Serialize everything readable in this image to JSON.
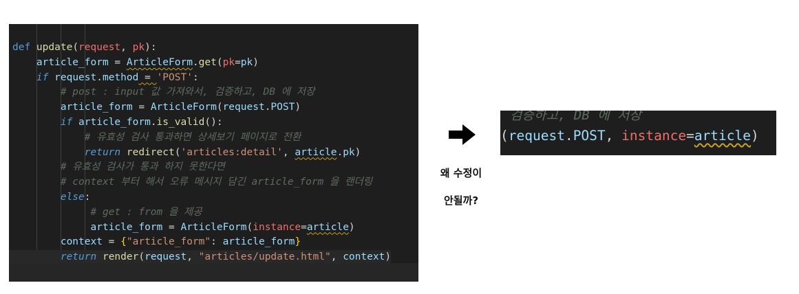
{
  "editor": {
    "language": "python",
    "lines": [
      [
        {
          "t": "def ",
          "c": "kw"
        },
        {
          "t": "update",
          "c": "fn"
        },
        {
          "t": "(",
          "c": "plain"
        },
        {
          "t": "request",
          "c": "par"
        },
        {
          "t": ", ",
          "c": "plain"
        },
        {
          "t": "pk",
          "c": "par"
        },
        {
          "t": "):",
          "c": "plain"
        }
      ],
      [
        {
          "t": "    ",
          "c": "plain"
        },
        {
          "t": "article_form",
          "c": "var"
        },
        {
          "t": " = ",
          "c": "plain"
        },
        {
          "t": "ArticleForm",
          "c": "var",
          "squig": true
        },
        {
          "t": ".",
          "c": "plain"
        },
        {
          "t": "get",
          "c": "fn"
        },
        {
          "t": "(",
          "c": "plain"
        },
        {
          "t": "pk",
          "c": "par"
        },
        {
          "t": "=",
          "c": "plain"
        },
        {
          "t": "pk",
          "c": "var"
        },
        {
          "t": ")",
          "c": "plain"
        }
      ],
      [
        {
          "t": "    ",
          "c": "plain"
        },
        {
          "t": "if",
          "c": "kwi"
        },
        {
          "t": " ",
          "c": "plain"
        },
        {
          "t": "request",
          "c": "var"
        },
        {
          "t": ".",
          "c": "plain"
        },
        {
          "t": "method",
          "c": "var"
        },
        {
          "t": " = ",
          "c": "plain",
          "squig": true
        },
        {
          "t": "'POST'",
          "c": "str"
        },
        {
          "t": ":",
          "c": "plain"
        }
      ],
      [
        {
          "t": "        ",
          "c": "plain"
        },
        {
          "t": "# post : input 값 가져와서, 검증하고, DB 에 저장",
          "c": "cm"
        }
      ],
      [
        {
          "t": "        ",
          "c": "plain"
        },
        {
          "t": "article_form",
          "c": "var"
        },
        {
          "t": " = ",
          "c": "plain"
        },
        {
          "t": "ArticleForm",
          "c": "var"
        },
        {
          "t": "(",
          "c": "plain"
        },
        {
          "t": "request",
          "c": "var"
        },
        {
          "t": ".",
          "c": "plain"
        },
        {
          "t": "POST",
          "c": "var"
        },
        {
          "t": ")",
          "c": "plain"
        }
      ],
      [
        {
          "t": "        ",
          "c": "plain"
        },
        {
          "t": "if",
          "c": "kwi"
        },
        {
          "t": " ",
          "c": "plain"
        },
        {
          "t": "article_form",
          "c": "var"
        },
        {
          "t": ".",
          "c": "plain"
        },
        {
          "t": "is_valid",
          "c": "fn"
        },
        {
          "t": "():",
          "c": "plain"
        }
      ],
      [
        {
          "t": "            ",
          "c": "plain"
        },
        {
          "t": "# 유효성 검사 통과하면 상세보기 페이지로 전환",
          "c": "cm"
        }
      ],
      [
        {
          "t": "            ",
          "c": "plain"
        },
        {
          "t": "return",
          "c": "kwi"
        },
        {
          "t": " ",
          "c": "plain"
        },
        {
          "t": "redirect",
          "c": "fn"
        },
        {
          "t": "(",
          "c": "plain"
        },
        {
          "t": "'articles:detail'",
          "c": "str"
        },
        {
          "t": ", ",
          "c": "plain"
        },
        {
          "t": "article",
          "c": "var",
          "squig": true
        },
        {
          "t": ".",
          "c": "plain"
        },
        {
          "t": "pk",
          "c": "var"
        },
        {
          "t": ")",
          "c": "plain"
        }
      ],
      [
        {
          "t": "        ",
          "c": "plain"
        },
        {
          "t": "# 유효성 검사가 통과 하지 못한다면",
          "c": "cm"
        }
      ],
      [
        {
          "t": "        ",
          "c": "plain"
        },
        {
          "t": "# context 부터 해서 오류 메시지 담긴 article_form 을 랜더링",
          "c": "cm"
        }
      ],
      [
        {
          "t": "        ",
          "c": "plain"
        },
        {
          "t": "else",
          "c": "kwi"
        },
        {
          "t": ":",
          "c": "plain"
        }
      ],
      [
        {
          "t": "             ",
          "c": "plain"
        },
        {
          "t": "# get : from 을 제공",
          "c": "cm"
        }
      ],
      [
        {
          "t": "             ",
          "c": "plain"
        },
        {
          "t": "article_form",
          "c": "var"
        },
        {
          "t": " = ",
          "c": "plain"
        },
        {
          "t": "ArticleForm",
          "c": "var"
        },
        {
          "t": "(",
          "c": "plain"
        },
        {
          "t": "instance",
          "c": "par"
        },
        {
          "t": "=",
          "c": "plain"
        },
        {
          "t": "article",
          "c": "var",
          "squig": true
        },
        {
          "t": ")",
          "c": "plain"
        }
      ],
      [
        {
          "t": "        ",
          "c": "plain"
        },
        {
          "t": "context",
          "c": "var"
        },
        {
          "t": " = ",
          "c": "plain"
        },
        {
          "t": "{",
          "c": "brace"
        },
        {
          "t": "\"article_form\"",
          "c": "str"
        },
        {
          "t": ": ",
          "c": "plain"
        },
        {
          "t": "article_form",
          "c": "var"
        },
        {
          "t": "}",
          "c": "brace"
        }
      ],
      [
        {
          "t": "        ",
          "c": "plain"
        },
        {
          "t": "return",
          "c": "kwi"
        },
        {
          "t": " ",
          "c": "plain"
        },
        {
          "t": "render",
          "c": "fn"
        },
        {
          "t": "(",
          "c": "plain"
        },
        {
          "t": "request",
          "c": "var"
        },
        {
          "t": ", ",
          "c": "plain"
        },
        {
          "t": "\"articles/update.html\"",
          "c": "str"
        },
        {
          "t": ", ",
          "c": "plain"
        },
        {
          "t": "context",
          "c": "var"
        },
        {
          "t": ")",
          "c": "plain"
        }
      ]
    ]
  },
  "arrow_icon": "right-arrow-icon",
  "question": {
    "line1": "왜 수정이",
    "line2": "안될까?"
  },
  "zoom": {
    "top_text": "검증하고, DB 에 저장",
    "tokens": [
      {
        "t": "(",
        "c": "plain"
      },
      {
        "t": "request",
        "c": "var"
      },
      {
        "t": ".",
        "c": "plain"
      },
      {
        "t": "POST",
        "c": "var"
      },
      {
        "t": ", ",
        "c": "plain"
      },
      {
        "t": "instance",
        "c": "par"
      },
      {
        "t": "=",
        "c": "plain"
      },
      {
        "t": "article",
        "c": "var",
        "squig": true
      },
      {
        "t": ")",
        "c": "plain"
      }
    ]
  },
  "colors": {
    "editor_bg": "#1e1e1e",
    "keyword": "#569cd6",
    "function": "#dcdcaa",
    "variable": "#9cdcfe",
    "parameter": "#ef6f6c",
    "string": "#ce9178",
    "comment": "#5f6b5f",
    "warning_squiggle": "#c9a227"
  }
}
